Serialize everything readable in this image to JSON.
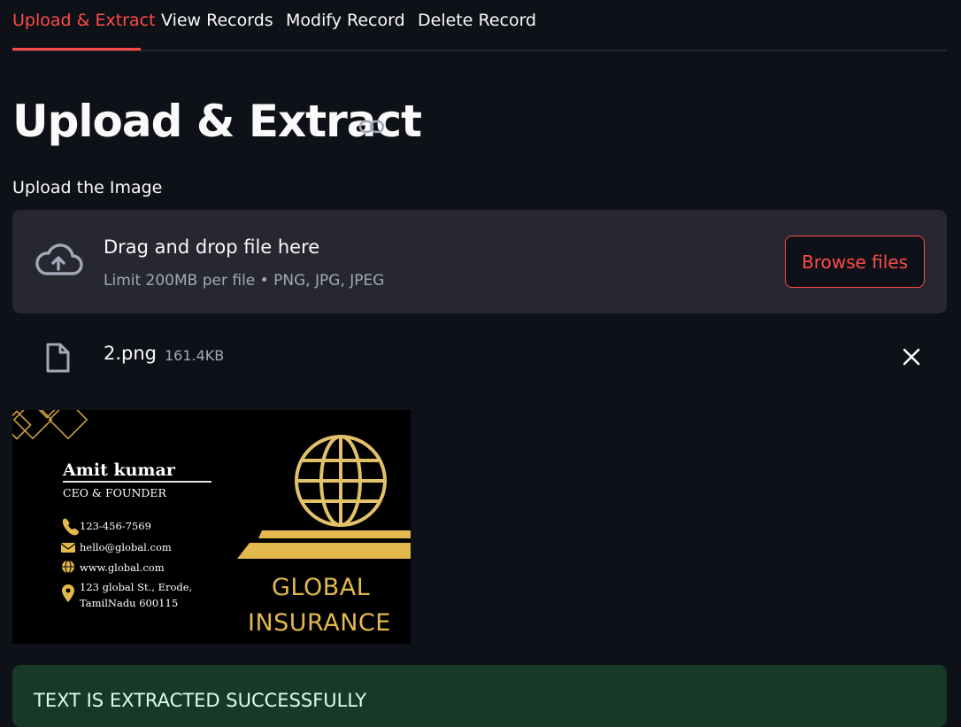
{
  "tabs": [
    {
      "label": "Upload & Extract",
      "active": true
    },
    {
      "label": "View Records",
      "active": false
    },
    {
      "label": "Modify Record",
      "active": false
    },
    {
      "label": "Delete Record",
      "active": false
    }
  ],
  "page": {
    "heading": "Upload & Extract",
    "heading_icon": "link-icon"
  },
  "uploader": {
    "label": "Upload the Image",
    "drop_title": "Drag and drop file here",
    "limit_text": "Limit 200MB per file • PNG, JPG, JPEG",
    "browse_label": "Browse files",
    "icon": "cloud-upload-icon"
  },
  "uploaded_file": {
    "name": "2.png",
    "size": "161.4KB",
    "icon": "file-icon",
    "remove_icon": "close-icon"
  },
  "card_image": {
    "name": "Amit kumar",
    "title": "CEO & FOUNDER",
    "phone": "123-456-7569",
    "email": "hello@global.com",
    "website": "www.global.com",
    "address_line1": "123 global St., Erode,",
    "address_line2": "TamilNadu 600115",
    "brand_line1": "GLOBAL",
    "brand_line2": "INSURANCE"
  },
  "status": {
    "message": "TEXT IS EXTRACTED SUCCESSFULLY"
  },
  "colors": {
    "background": "#0e1117",
    "accent": "#ff4b4b",
    "surface": "#262730",
    "success_bg": "#173928",
    "gold": "#e3b84c"
  }
}
